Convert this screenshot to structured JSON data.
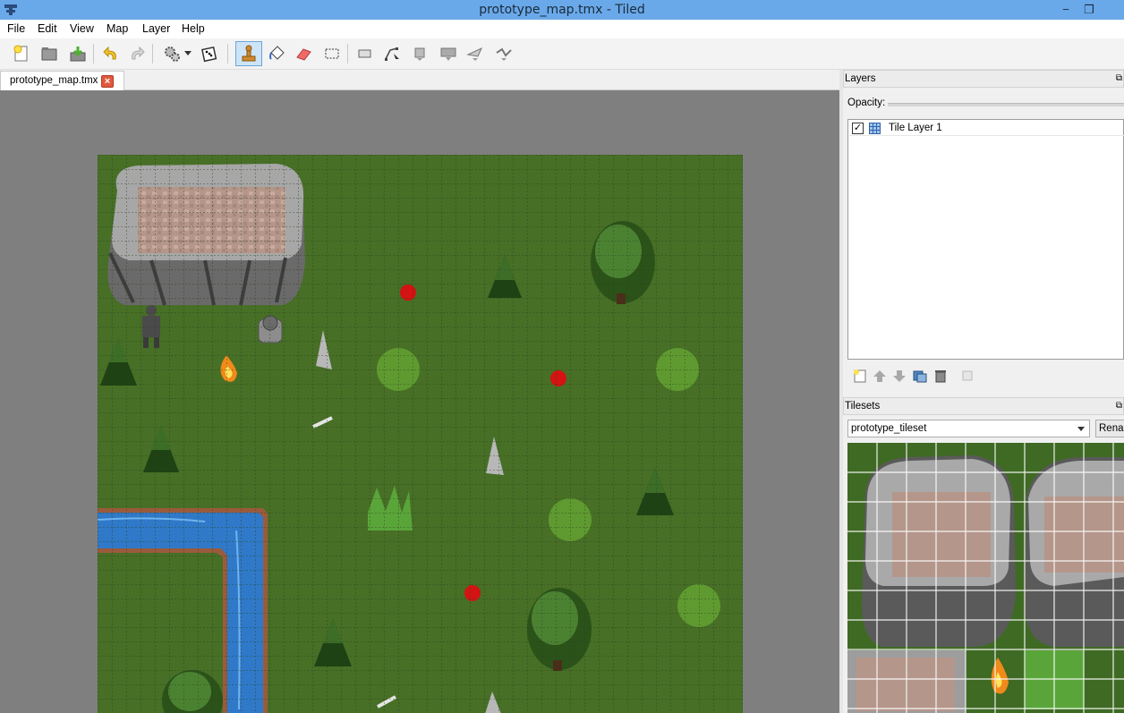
{
  "window": {
    "title": "prototype_map.tmx - Tiled",
    "minimize": "−",
    "restore": "❐"
  },
  "menu": [
    "File",
    "Edit",
    "View",
    "Map",
    "Layer",
    "Help"
  ],
  "toolbar": {
    "tools": [
      "new-map",
      "open-file",
      "save-file",
      "undo",
      "redo",
      "automap",
      "random-mode",
      "stamp-brush",
      "bucket-fill",
      "eraser",
      "rectangular-select",
      "select-objects",
      "edit-polygons",
      "insert-rectangle",
      "insert-tile",
      "insert-polygon",
      "insert-polyline"
    ],
    "active_tool": "stamp-brush"
  },
  "document_tabs": [
    {
      "label": "prototype_map.tmx",
      "close": "×"
    }
  ],
  "layers_panel": {
    "title": "Layers",
    "float_icon": "⧉",
    "opacity_label": "Opacity:",
    "layers": [
      {
        "name": "Tile Layer 1",
        "visible": true
      }
    ]
  },
  "tilesets_panel": {
    "title": "Tilesets",
    "float_icon": "⧉",
    "selected_tileset": "prototype_tileset",
    "rename_label": "Renar"
  },
  "colors": {
    "titlebar": "#6aa9e9",
    "grass": "#476f26",
    "water": "#2f79c8",
    "map_background": "#7f7f7f",
    "active_tool": "#cde4f7"
  }
}
